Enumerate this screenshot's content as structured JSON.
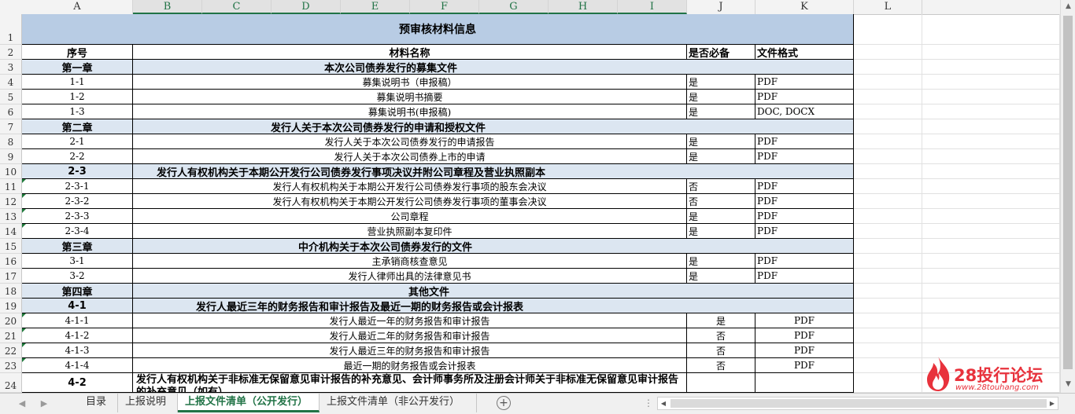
{
  "columns": [
    "A",
    "B",
    "C",
    "D",
    "E",
    "F",
    "G",
    "H",
    "I",
    "J",
    "K",
    "L"
  ],
  "title": "预审核材料信息",
  "header": {
    "seq": "序号",
    "name": "材料名称",
    "required": "是否必备",
    "format": "文件格式"
  },
  "rows": [
    {
      "num": "3",
      "seq": "第一章",
      "name": "本次公司债券发行的募集文件",
      "type": "section"
    },
    {
      "num": "4",
      "seq": "1-1",
      "name": "募集说明书（申报稿）",
      "required": "是",
      "format": "PDF",
      "type": "item"
    },
    {
      "num": "5",
      "seq": "1-2",
      "name": "募集说明书摘要",
      "required": "是",
      "format": "PDF",
      "type": "item"
    },
    {
      "num": "6",
      "seq": "1-3",
      "name": "募集说明书(申报稿)",
      "required": "是",
      "format": "DOC, DOCX",
      "type": "item"
    },
    {
      "num": "7",
      "seq": "第二章",
      "name": "发行人关于本次公司债券发行的申请和授权文件",
      "type": "section"
    },
    {
      "num": "8",
      "seq": "2-1",
      "name": "发行人关于本次公司债券发行的申请报告",
      "required": "是",
      "format": "PDF",
      "type": "item"
    },
    {
      "num": "9",
      "seq": "2-2",
      "name": "发行人关于本次公司债券上市的申请",
      "required": "是",
      "format": "PDF",
      "type": "item"
    },
    {
      "num": "10",
      "seq": "2-3",
      "name": "发行人有权机构关于本期公开发行公司债券发行事项决议并附公司章程及营业执照副本",
      "type": "section"
    },
    {
      "num": "11",
      "seq": "2-3-1",
      "name": "发行人有权机构关于本期公开发行公司债券发行事项的股东会决议",
      "required": "否",
      "format": "PDF",
      "type": "item",
      "tri": true
    },
    {
      "num": "12",
      "seq": "2-3-2",
      "name": "发行人有权机构关于本期公开发行公司债券发行事项的董事会决议",
      "required": "否",
      "format": "PDF",
      "type": "item",
      "tri": true
    },
    {
      "num": "13",
      "seq": "2-3-3",
      "name": "公司章程",
      "required": "是",
      "format": "PDF",
      "type": "item",
      "tri": true
    },
    {
      "num": "14",
      "seq": "2-3-4",
      "name": "营业执照副本复印件",
      "required": "是",
      "format": "PDF",
      "type": "item",
      "tri": true
    },
    {
      "num": "15",
      "seq": "第三章",
      "name": "中介机构关于本次公司债券发行的文件",
      "type": "section"
    },
    {
      "num": "16",
      "seq": "3-1",
      "name": "主承销商核查意见",
      "required": "是",
      "format": "PDF",
      "type": "item"
    },
    {
      "num": "17",
      "seq": "3-2",
      "name": "发行人律师出具的法律意见书",
      "required": "是",
      "format": "PDF",
      "type": "item"
    },
    {
      "num": "18",
      "seq": "第四章",
      "name": "其他文件",
      "type": "section"
    },
    {
      "num": "19",
      "seq": "4-1",
      "name": "发行人最近三年的财务报告和审计报告及最近一期的财务报告或会计报表",
      "type": "section"
    },
    {
      "num": "20",
      "seq": "4-1-1",
      "name": "发行人最近一年的财务报告和审计报告",
      "required": "是",
      "format": "PDF",
      "type": "item2",
      "tri": true
    },
    {
      "num": "21",
      "seq": "4-1-2",
      "name": "发行人最近二年的财务报告和审计报告",
      "required": "否",
      "format": "PDF",
      "type": "item2",
      "tri": true
    },
    {
      "num": "22",
      "seq": "4-1-3",
      "name": "发行人最近三年的财务报告和审计报告",
      "required": "否",
      "format": "PDF",
      "type": "item2",
      "tri": true
    },
    {
      "num": "23",
      "seq": "4-1-4",
      "name": "最近一期的财务报告或会计报表",
      "required": "否",
      "format": "PDF",
      "type": "item2",
      "tri": true
    },
    {
      "num": "24",
      "seq": "4-2",
      "name": "发行人有权机构关于非标准无保留意见审计报告的补充意见、会计师事务所及注册会计师关于非标准无保留意见审计报告的补充意见（如有）",
      "type": "partial"
    }
  ],
  "tabs": [
    "目录",
    "上报说明",
    "上报文件清单（公开发行）",
    "上报文件清单（非公开发行）"
  ],
  "active_tab": 2,
  "watermark": {
    "brand": "28投行论坛",
    "url": "www.28touhang.com"
  }
}
